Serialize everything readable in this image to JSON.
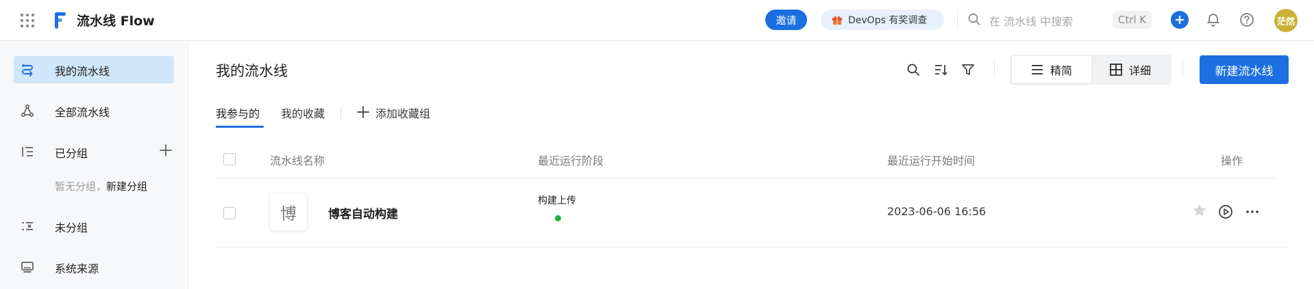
{
  "topbar": {
    "app_title": "流水线 Flow",
    "invite_label": "邀请",
    "survey_label": "DevOps 有奖调查",
    "search_placeholder": "在 流水线 中搜索",
    "shortcut": "Ctrl K",
    "avatar_text": "茫然",
    "accent_color": "#1b6fe0"
  },
  "sidebar": {
    "items": [
      {
        "label": "我的流水线",
        "icon": "pipeline-icon",
        "active": true
      },
      {
        "label": "全部流水线",
        "icon": "nodes-icon",
        "active": false
      },
      {
        "label": "已分组",
        "icon": "grouped-list-icon",
        "active": false
      },
      {
        "label": "未分组",
        "icon": "ungrouped-list-icon",
        "active": false
      },
      {
        "label": "系统来源",
        "icon": "monitor-icon",
        "active": false
      }
    ],
    "no_group_text": "暂无分组，",
    "new_group_link": "新建分组"
  },
  "main": {
    "title": "我的流水线",
    "view_simple": "精简",
    "view_detail": "详细",
    "new_pipeline_label": "新建流水线",
    "tabs": [
      {
        "label": "我参与的",
        "active": true
      },
      {
        "label": "我的收藏",
        "active": false
      }
    ],
    "add_fav_group": "添加收藏组",
    "table": {
      "columns": [
        "流水线名称",
        "最近运行阶段",
        "最近运行开始时间",
        "操作"
      ],
      "rows": [
        {
          "avatar": "博",
          "name": "博客自动构建",
          "stage": "构建上传",
          "stage_status_color": "#1db03b",
          "start_time": "2023-06-06 16:56"
        }
      ]
    }
  }
}
